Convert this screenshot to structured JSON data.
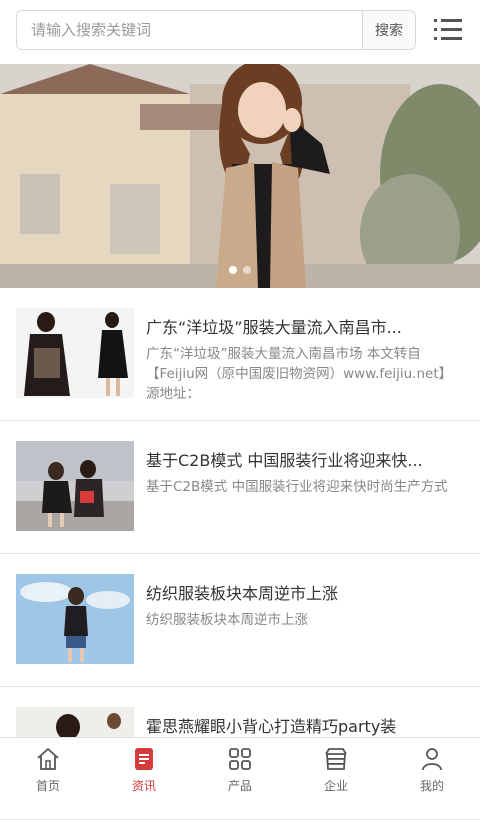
{
  "search": {
    "placeholder": "请输入搜索关键词",
    "button_label": "搜索"
  },
  "menu": {
    "icon": "list-menu-icon"
  },
  "banner": {
    "slides": 2,
    "active_index": 0
  },
  "news": [
    {
      "title": "广东“洋垃圾”服装大量流入南昌市...",
      "summary": "广东“洋垃圾”服装大量流入南昌市场 本文转自【Feijiu网（原中国废旧物资网）www.feijiu.net】 源地址："
    },
    {
      "title": "基于C2B模式 中国服装行业将迎来快...",
      "summary": "基于C2B模式 中国服装行业将迎来快时尚生产方式"
    },
    {
      "title": "纺织服装板块本周逆市上涨",
      "summary": "纺织服装板块本周逆市上涨"
    },
    {
      "title": "霍思燕耀眼小背心打造精巧party装",
      "summary": ""
    }
  ],
  "tabs": [
    {
      "label": "首页",
      "icon": "home-icon",
      "active": false
    },
    {
      "label": "资讯",
      "icon": "news-icon",
      "active": true
    },
    {
      "label": "产品",
      "icon": "grid-icon",
      "active": false
    },
    {
      "label": "企业",
      "icon": "enterprise-icon",
      "active": false
    },
    {
      "label": "我的",
      "icon": "user-icon",
      "active": false
    }
  ],
  "colors": {
    "accent": "#d43a3a",
    "inactive": "#666666"
  }
}
